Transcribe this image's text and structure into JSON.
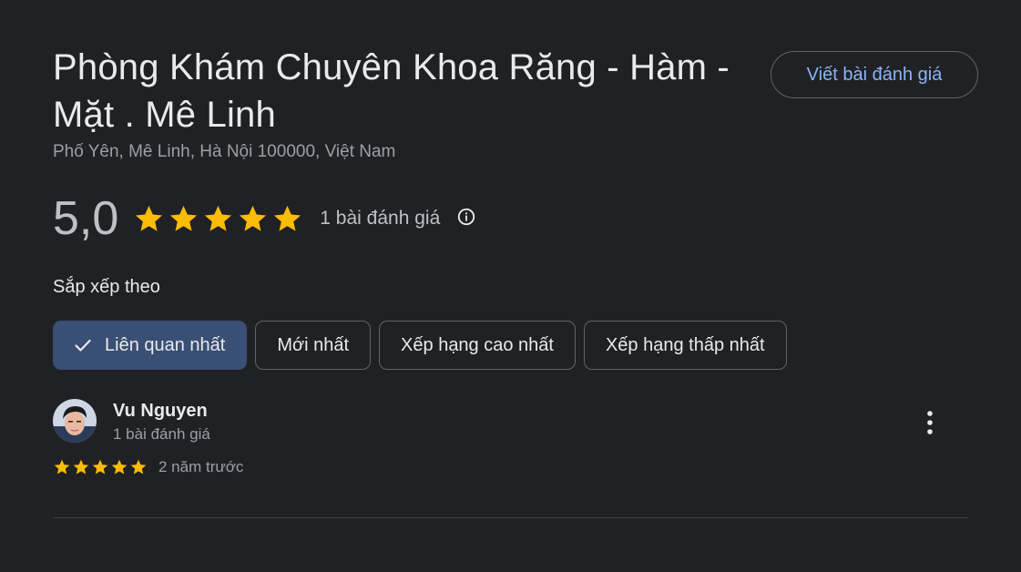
{
  "place": {
    "title": "Phòng Khám Chuyên Khoa Răng - Hàm - Mặt . Mê Linh",
    "address": "Phố Yên, Mê Linh, Hà Nội 100000, Việt Nam"
  },
  "actions": {
    "write_review_label": "Viết bài đánh giá"
  },
  "rating": {
    "value": "5,0",
    "stars": 5,
    "review_count": "1 bài đánh giá",
    "info_icon": "info-icon"
  },
  "sort": {
    "label": "Sắp xếp theo",
    "chips": [
      {
        "label": "Liên quan nhất",
        "selected": true
      },
      {
        "label": "Mới nhất",
        "selected": false
      },
      {
        "label": "Xếp hạng cao nhất",
        "selected": false
      },
      {
        "label": "Xếp hạng thấp nhất",
        "selected": false
      }
    ]
  },
  "reviews": [
    {
      "author": "Vu Nguyen",
      "author_sub": "1 bài đánh giá",
      "stars": 5,
      "time": "2 năm trước"
    }
  ],
  "colors": {
    "background": "#202124",
    "star": "#fbbc04",
    "accent_link": "#8ab4f8",
    "selected_chip": "#394f73"
  }
}
